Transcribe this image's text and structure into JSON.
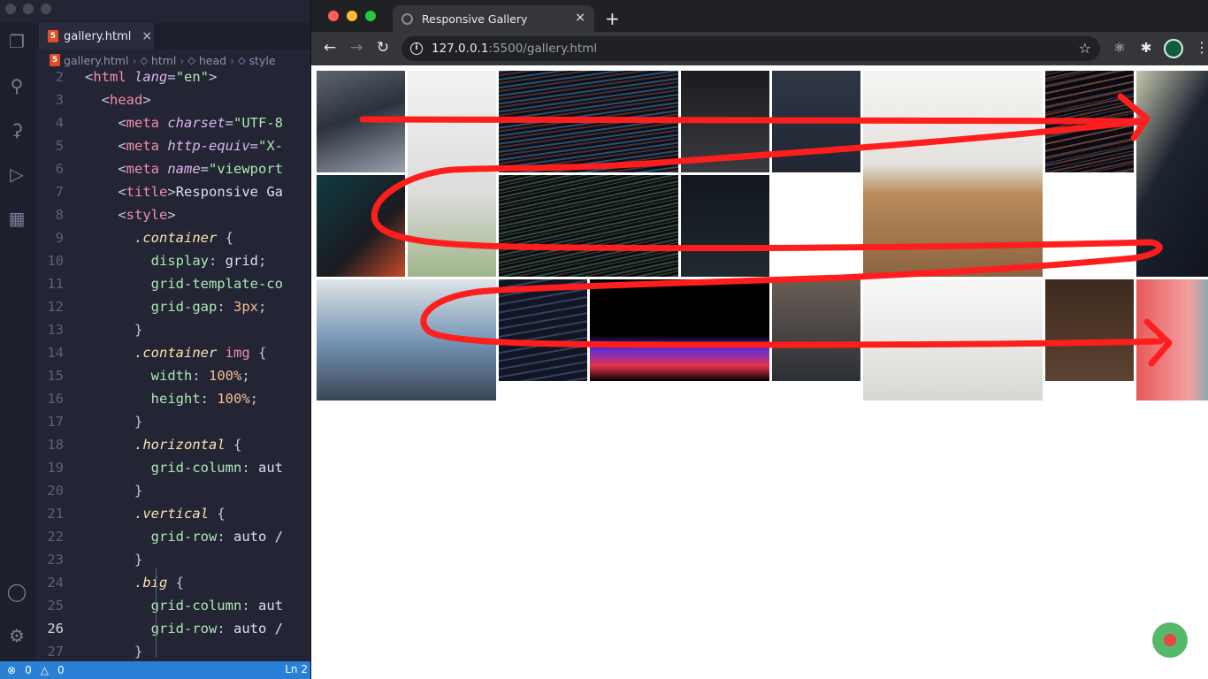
{
  "vscode": {
    "tab": {
      "label": "gallery.html",
      "icon": "html5-icon"
    },
    "breadcrumbs": [
      "gallery.html",
      "html",
      "head",
      "style"
    ],
    "code_lines": [
      {
        "n": "2",
        "tokens": [
          [
            "c-punc",
            "<"
          ],
          [
            "c-tag",
            "html "
          ],
          [
            "c-attr",
            "lang"
          ],
          [
            "c-punc",
            "="
          ],
          [
            "c-str",
            "\"en\""
          ],
          [
            "c-punc",
            ">"
          ]
        ],
        "indent": 0
      },
      {
        "n": "3",
        "tokens": [
          [
            "c-punc",
            "<"
          ],
          [
            "c-tag",
            "head"
          ],
          [
            "c-punc",
            ">"
          ]
        ],
        "indent": 1
      },
      {
        "n": "4",
        "tokens": [
          [
            "c-punc",
            "<"
          ],
          [
            "c-tag",
            "meta "
          ],
          [
            "c-attr",
            "charset"
          ],
          [
            "c-punc",
            "="
          ],
          [
            "c-str",
            "\"UTF-8"
          ]
        ],
        "indent": 2
      },
      {
        "n": "5",
        "tokens": [
          [
            "c-punc",
            "<"
          ],
          [
            "c-tag",
            "meta "
          ],
          [
            "c-attr",
            "http-equiv"
          ],
          [
            "c-punc",
            "="
          ],
          [
            "c-str",
            "\"X-"
          ]
        ],
        "indent": 2
      },
      {
        "n": "6",
        "tokens": [
          [
            "c-punc",
            "<"
          ],
          [
            "c-tag",
            "meta "
          ],
          [
            "c-attr",
            "name"
          ],
          [
            "c-punc",
            "="
          ],
          [
            "c-str",
            "\"viewport"
          ]
        ],
        "indent": 2
      },
      {
        "n": "7",
        "tokens": [
          [
            "c-punc",
            "<"
          ],
          [
            "c-tag",
            "title"
          ],
          [
            "c-punc",
            ">"
          ],
          [
            "c-text",
            "Responsive Ga"
          ]
        ],
        "indent": 2
      },
      {
        "n": "8",
        "tokens": [
          [
            "c-punc",
            "<"
          ],
          [
            "c-tag",
            "style"
          ],
          [
            "c-punc",
            ">"
          ]
        ],
        "indent": 2
      },
      {
        "n": "9",
        "tokens": [
          [
            "c-sel",
            ".container"
          ],
          [
            "c-punc",
            " {"
          ]
        ],
        "indent": 3
      },
      {
        "n": "10",
        "tokens": [
          [
            "c-prop",
            "display"
          ],
          [
            "c-punc",
            ": "
          ],
          [
            "c-text",
            "grid"
          ],
          [
            "c-punc",
            ";"
          ]
        ],
        "indent": 4
      },
      {
        "n": "11",
        "tokens": [
          [
            "c-prop",
            "grid-template-co"
          ]
        ],
        "indent": 4
      },
      {
        "n": "12",
        "tokens": [
          [
            "c-prop",
            "grid-gap"
          ],
          [
            "c-punc",
            ": "
          ],
          [
            "c-num",
            "3px"
          ],
          [
            "c-punc",
            ";"
          ]
        ],
        "indent": 4
      },
      {
        "n": "13",
        "tokens": [
          [
            "c-punc",
            "}"
          ]
        ],
        "indent": 3
      },
      {
        "n": "14",
        "tokens": [
          [
            "c-sel",
            ".container "
          ],
          [
            "c-tag",
            "img"
          ],
          [
            "c-punc",
            " {"
          ]
        ],
        "indent": 3
      },
      {
        "n": "15",
        "tokens": [
          [
            "c-prop",
            "width"
          ],
          [
            "c-punc",
            ": "
          ],
          [
            "c-num",
            "100%"
          ],
          [
            "c-punc",
            ";"
          ]
        ],
        "indent": 4
      },
      {
        "n": "16",
        "tokens": [
          [
            "c-prop",
            "height"
          ],
          [
            "c-punc",
            ": "
          ],
          [
            "c-num",
            "100%"
          ],
          [
            "c-punc",
            ";"
          ]
        ],
        "indent": 4
      },
      {
        "n": "17",
        "tokens": [
          [
            "c-punc",
            "}"
          ]
        ],
        "indent": 3
      },
      {
        "n": "18",
        "tokens": [
          [
            "c-sel",
            ".horizontal"
          ],
          [
            "c-punc",
            " {"
          ]
        ],
        "indent": 3
      },
      {
        "n": "19",
        "tokens": [
          [
            "c-prop",
            "grid-column"
          ],
          [
            "c-punc",
            ": "
          ],
          [
            "c-text",
            "aut"
          ]
        ],
        "indent": 4
      },
      {
        "n": "20",
        "tokens": [
          [
            "c-punc",
            "}"
          ]
        ],
        "indent": 3
      },
      {
        "n": "21",
        "tokens": [
          [
            "c-sel",
            ".vertical"
          ],
          [
            "c-punc",
            " {"
          ]
        ],
        "indent": 3
      },
      {
        "n": "22",
        "tokens": [
          [
            "c-prop",
            "grid-row"
          ],
          [
            "c-punc",
            ": "
          ],
          [
            "c-text",
            "auto /"
          ]
        ],
        "indent": 4
      },
      {
        "n": "23",
        "tokens": [
          [
            "c-punc",
            "}"
          ]
        ],
        "indent": 3
      },
      {
        "n": "24",
        "tokens": [
          [
            "c-sel",
            ".big"
          ],
          [
            "c-punc",
            " {"
          ]
        ],
        "indent": 3
      },
      {
        "n": "25",
        "tokens": [
          [
            "c-prop",
            "grid-column"
          ],
          [
            "c-punc",
            ": "
          ],
          [
            "c-text",
            "aut"
          ]
        ],
        "indent": 4
      },
      {
        "n": "26",
        "tokens": [
          [
            "c-prop",
            "grid-row"
          ],
          [
            "c-punc",
            ": "
          ],
          [
            "c-text",
            "auto /"
          ]
        ],
        "indent": 4,
        "active": true
      },
      {
        "n": "27",
        "tokens": [
          [
            "c-punc",
            "}"
          ]
        ],
        "indent": 3
      }
    ],
    "status": {
      "errors": "0",
      "warnings": "0",
      "position": "Ln 2"
    }
  },
  "browser": {
    "tab_title": "Responsive Gallery",
    "url_host": "127.0.0.1",
    "url_rest": ":5500/gallery.html"
  },
  "gallery": {
    "tiles": [
      {
        "name": "photo-laptop-desk",
        "span": "",
        "style": "p1"
      },
      {
        "name": "photo-tablet-plant",
        "span": "g-v",
        "style": "p2"
      },
      {
        "name": "photo-code-closeup",
        "span": "g-h",
        "style": "p3"
      },
      {
        "name": "photo-dark-monitors",
        "span": "",
        "style": "p4"
      },
      {
        "name": "photo-desk-monitor",
        "span": "",
        "style": "p5"
      },
      {
        "name": "photo-wood-desk-setup",
        "span": "g-b",
        "style": "p6"
      },
      {
        "name": "photo-colored-code",
        "span": "",
        "style": "p7"
      },
      {
        "name": "photo-laptop-code-side",
        "span": "g-v",
        "style": "p8"
      },
      {
        "name": "photo-headphones",
        "span": "",
        "style": "p9"
      },
      {
        "name": "photo-code-editor-big",
        "span": "g-h",
        "style": "p11"
      },
      {
        "name": "photo-dark-room",
        "span": "",
        "style": "p12"
      },
      {
        "name": "photo-office-worker",
        "span": "g-h",
        "style": "p13"
      },
      {
        "name": "photo-code-small",
        "span": "",
        "style": "p14"
      },
      {
        "name": "photo-black-neon",
        "span": "g-h",
        "style": "p15"
      },
      {
        "name": "photo-man-at-desk",
        "span": "",
        "style": "p16"
      },
      {
        "name": "photo-man-glasses",
        "span": "g-v",
        "style": "p17"
      },
      {
        "name": "photo-laptop-top-view",
        "span": "",
        "style": "p18"
      },
      {
        "name": "photo-hand-lightbulb",
        "span": "",
        "style": "p19"
      }
    ],
    "annotation_color": "#ff1e1e"
  }
}
